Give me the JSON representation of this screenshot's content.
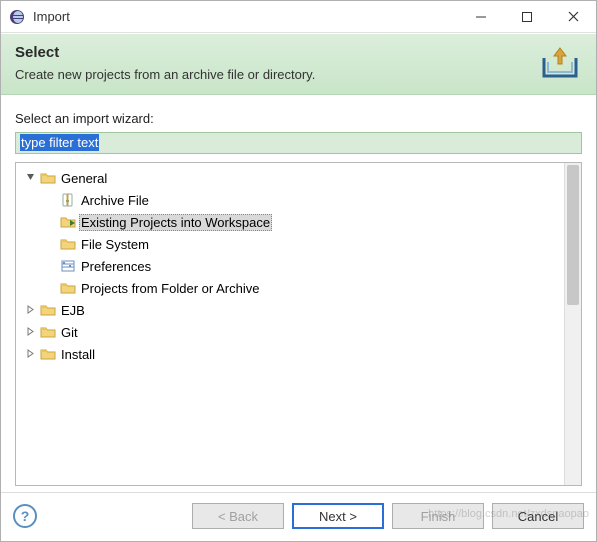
{
  "window": {
    "title": "Import"
  },
  "banner": {
    "heading": "Select",
    "description": "Create new projects from an archive file or directory."
  },
  "content": {
    "label": "Select an import wizard:",
    "filter_value": "type filter text",
    "tree": {
      "nodes": [
        {
          "label": "General",
          "kind": "folder-open",
          "expandable": true,
          "expanded": true,
          "depth": 0,
          "selected": false
        },
        {
          "label": "Archive File",
          "kind": "archive",
          "expandable": false,
          "depth": 1,
          "selected": false
        },
        {
          "label": "Existing Projects into Workspace",
          "kind": "project",
          "expandable": false,
          "depth": 1,
          "selected": true
        },
        {
          "label": "File System",
          "kind": "folder",
          "expandable": false,
          "depth": 1,
          "selected": false
        },
        {
          "label": "Preferences",
          "kind": "prefs",
          "expandable": false,
          "depth": 1,
          "selected": false
        },
        {
          "label": "Projects from Folder or Archive",
          "kind": "folder",
          "expandable": false,
          "depth": 1,
          "selected": false
        },
        {
          "label": "EJB",
          "kind": "folder-closed",
          "expandable": true,
          "expanded": false,
          "depth": 0,
          "selected": false
        },
        {
          "label": "Git",
          "kind": "folder-closed",
          "expandable": true,
          "expanded": false,
          "depth": 0,
          "selected": false
        },
        {
          "label": "Install",
          "kind": "folder-closed",
          "expandable": true,
          "expanded": false,
          "depth": 0,
          "selected": false
        }
      ]
    }
  },
  "buttons": {
    "back": "< Back",
    "next": "Next >",
    "finish": "Finish",
    "cancel": "Cancel"
  },
  "watermark": "https://blog.csdn.net/zxdspaopao"
}
